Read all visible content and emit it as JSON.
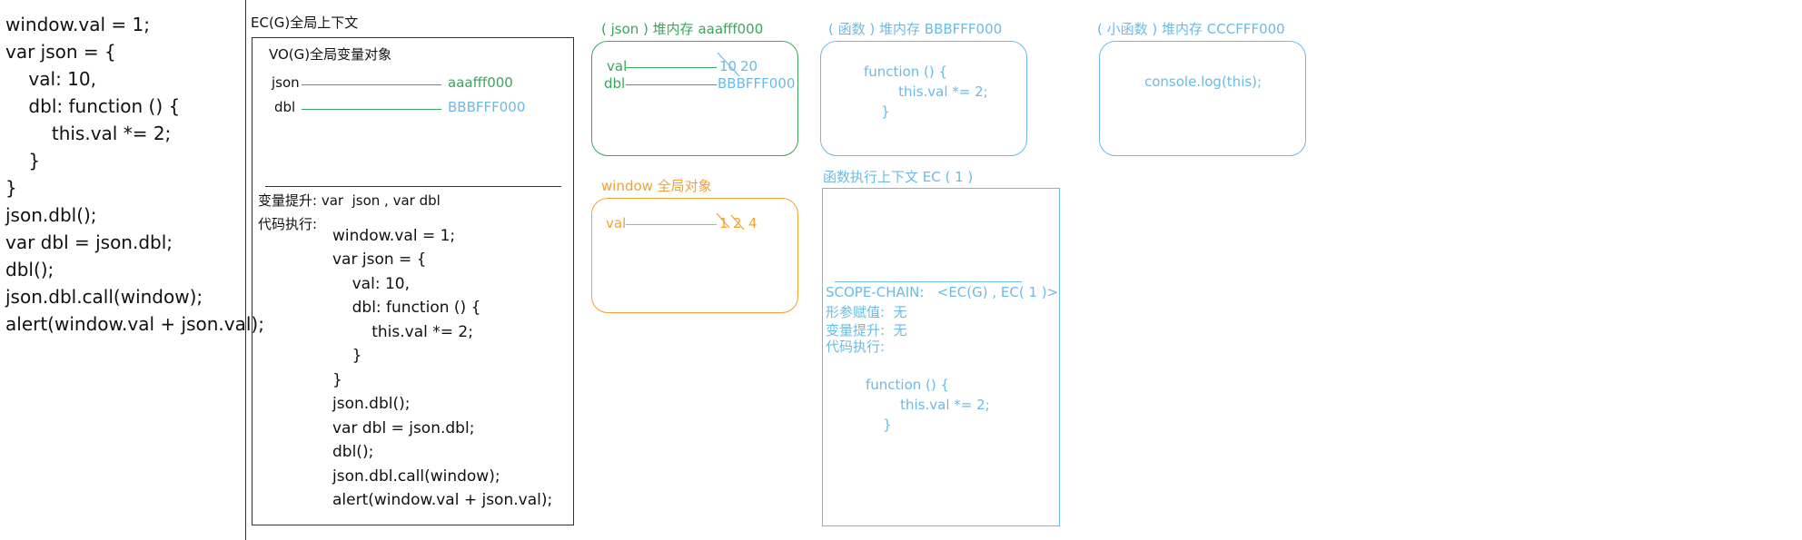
{
  "left_code": [
    "window.val = 1;",
    "var json = {",
    "    val: 10,",
    "    dbl: function () {",
    "        this.val *= 2;",
    "    }",
    "}",
    "json.dbl();",
    "var dbl = json.dbl;",
    "dbl();",
    "json.dbl.call(window);",
    "alert(window.val + json.val);"
  ],
  "global_ec": {
    "title": "EC(G)全局上下文",
    "vo_title": "VO(G)全局变量对象",
    "json_label": "json",
    "json_value": "aaafff000",
    "dbl_label": "dbl",
    "dbl_value": "BBBFFF000",
    "hoisting": "变量提升: var  json , var dbl",
    "exec_label": "代码执行:",
    "code": [
      "window.val = 1;",
      "var json = {",
      "    val: 10,",
      "    dbl: function () {",
      "        this.val *= 2;",
      "    }",
      "}",
      "json.dbl();",
      "var dbl = json.dbl;",
      "dbl();",
      "json.dbl.call(window);",
      "alert(window.val + json.val);"
    ]
  },
  "json_heap": {
    "title": "( json ) 堆内存 aaafff000",
    "val_label": "val",
    "val_old": "10",
    "val_new": "20",
    "dbl_label": "dbl",
    "dbl_value": "BBBFFF000"
  },
  "window_obj": {
    "title": "window 全局对象",
    "val_label": "val",
    "val_old1": "1",
    "val_old2": "2",
    "val_new": "4"
  },
  "func_heap": {
    "title": "( 函数 ) 堆内存 BBBFFF000",
    "code": [
      "function () {",
      "        this.val *= 2;",
      "    }"
    ]
  },
  "small_func_heap": {
    "title": "( 小函数 ) 堆内存 CCCFFF000",
    "code": "console.log(this);"
  },
  "func_ec": {
    "title": "函数执行上下文 EC ( 1 )",
    "scope_chain": "SCOPE-CHAIN:   <EC(G) , EC( 1 )>",
    "params": "形参赋值:  无",
    "hoisting": "变量提升:  无",
    "exec_label": "代码执行:",
    "code": [
      "function () {",
      "        this.val *= 2;",
      "    }"
    ]
  },
  "colors": {
    "green": "#3aa55c",
    "blue": "#6bbbe3",
    "orange": "#f2a230"
  }
}
